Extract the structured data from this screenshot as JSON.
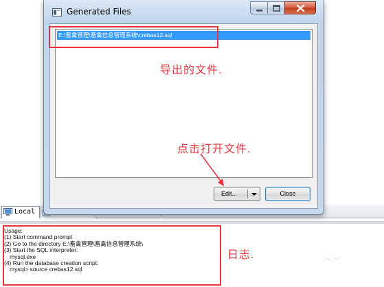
{
  "dialog": {
    "title": "Generated Files",
    "caption_buttons": {
      "minimize_icon": "minimize-icon",
      "maximize_icon": "maximize-icon",
      "close_icon": "close-x-icon"
    },
    "file_list": [
      "E:\\畜禽管理\\畜禽信息管理系统\\crebas12.sql"
    ],
    "edit_button_label": "Edit...",
    "close_button_label": "Close"
  },
  "annotations": {
    "export_label": "导出的文件.",
    "click_label": "点击打开文件.",
    "log_label": "日志."
  },
  "background": {
    "tab_local_label": "Local",
    "log_lines": [
      "Usage:",
      "(1) Start command prompt",
      "(2) Go to the directory E:\\畜禽管理\\畜禽信息管理系统\\",
      "(3) Start the SQL interpreter:",
      "mysql.exe",
      "(4) Run the database creation script:",
      "mysql> source crebas12.sql"
    ]
  },
  "colors": {
    "annotation_red": "#e8323c",
    "selection_blue": "#3399ff",
    "close_button_red": "#c13c1c"
  }
}
